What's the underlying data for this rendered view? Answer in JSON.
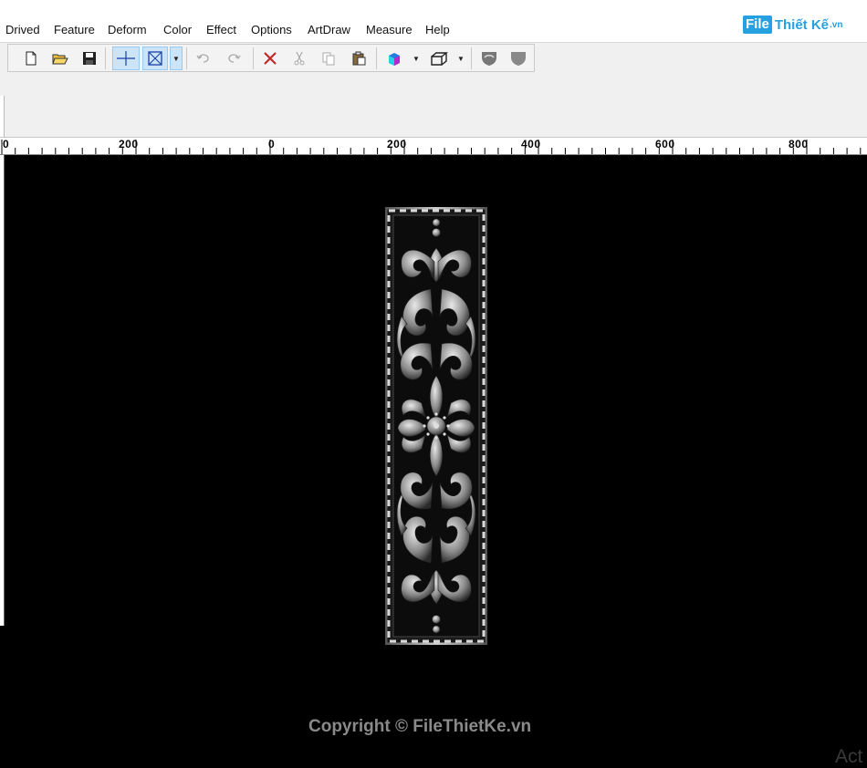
{
  "menu": {
    "items": [
      "Drived",
      "Feature",
      "Deform",
      "Color",
      "Effect",
      "Options",
      "ArtDraw",
      "Measure",
      "Help"
    ]
  },
  "logo": {
    "box_text": "File",
    "text": "Thiết Kế",
    "suffix": ".vn"
  },
  "toolbar": {
    "buttons": [
      {
        "icon": "new-file-icon"
      },
      {
        "icon": "open-folder-icon"
      },
      {
        "icon": "save-icon"
      },
      {
        "icon": "crosshair-select-icon",
        "active": true
      },
      {
        "icon": "box-select-icon",
        "active": true
      },
      {
        "icon": "undo-icon",
        "disabled": true
      },
      {
        "icon": "redo-icon",
        "disabled": true
      },
      {
        "icon": "delete-icon"
      },
      {
        "icon": "cut-icon",
        "disabled": true
      },
      {
        "icon": "copy-icon",
        "disabled": true
      },
      {
        "icon": "paste-icon"
      },
      {
        "icon": "shaded-view-icon"
      },
      {
        "icon": "wireframe-view-icon"
      },
      {
        "icon": "relief-shield-icon"
      },
      {
        "icon": "relief-flat-icon"
      }
    ]
  },
  "ruler": {
    "labels": [
      "0",
      "200",
      "0",
      "200",
      "400",
      "600",
      "800"
    ]
  },
  "canvas": {
    "copyright": "Copyright © FileThietKe.vn",
    "watermark": "Act"
  },
  "colors": {
    "canvas_bg": "#000000",
    "menu_bg": "#ffffff",
    "toolbar_bg": "#f0f0f0",
    "active_button": "#cce4f7",
    "logo_blue": "#27a0e0"
  }
}
